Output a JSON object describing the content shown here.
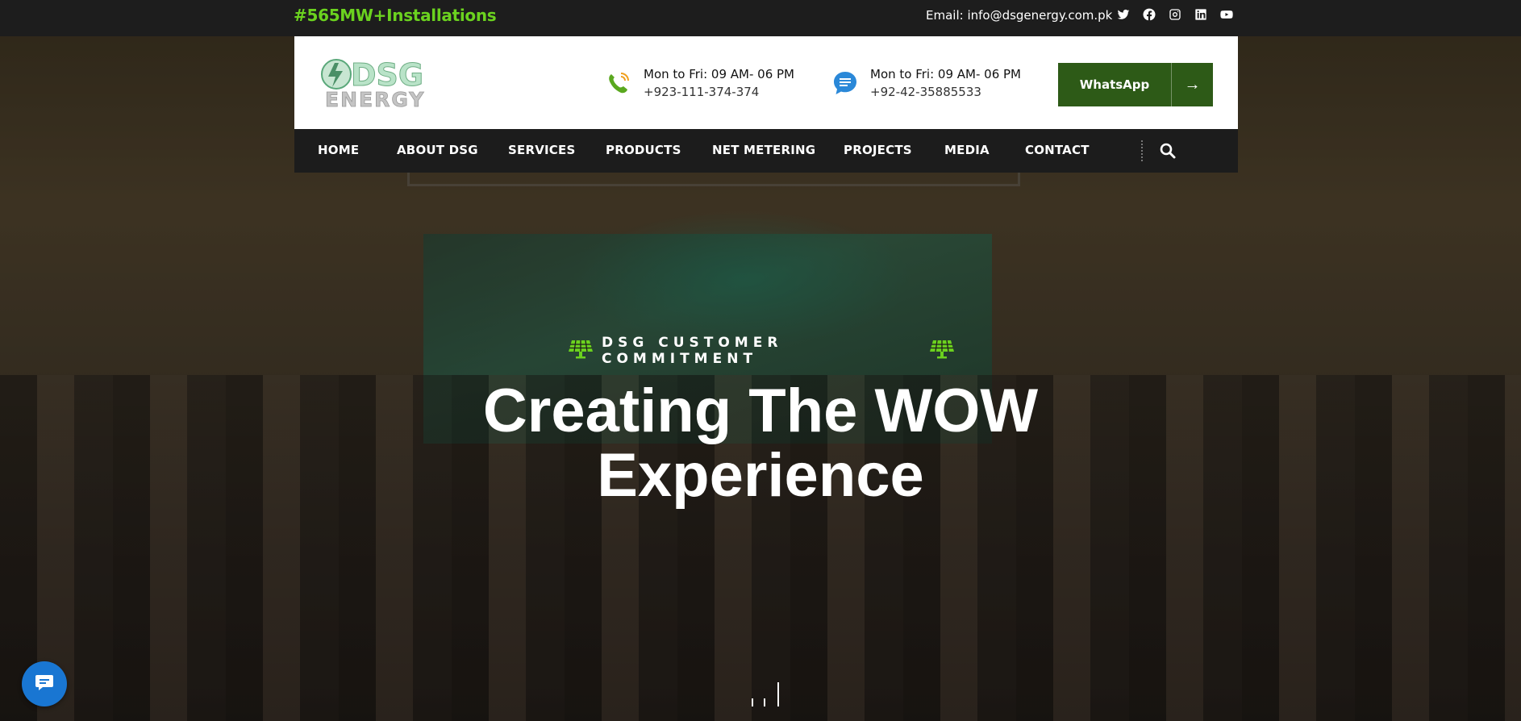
{
  "topbar": {
    "installations": "#565MW+Installations",
    "email": "Email: info@dsgenergy.com.pk",
    "socials": [
      "twitter-icon",
      "facebook-icon",
      "instagram-icon",
      "linkedin-icon",
      "youtube-icon"
    ]
  },
  "header": {
    "logo_top": "DSG",
    "logo_bottom": "ENERGY",
    "contacts": [
      {
        "hours": "Mon to Fri: 09 AM- 06 PM",
        "value": "+923-111-374-374",
        "icon": "phone-icon"
      },
      {
        "hours": "Mon to Fri: 09 AM- 06 PM",
        "value": "+92-42-35885533",
        "icon": "chat-icon"
      }
    ],
    "cta_label": "WhatsApp",
    "cta_arrow": "→"
  },
  "nav": {
    "items": [
      "HOME",
      "ABOUT DSG",
      "SERVICES",
      "PRODUCTS",
      "NET METERING",
      "PROJECTS",
      "MEDIA",
      "CONTACT"
    ]
  },
  "hero": {
    "tagline": "DSG CUSTOMER COMMITMENT",
    "headline_line1": "Creating The WOW",
    "headline_line2": "Experience"
  },
  "colors": {
    "accent_green": "#6bd21f",
    "cta_green": "#2d5a17",
    "topbar": "#1d1d1d",
    "nav": "#1c1c1c",
    "chat_blue": "#1976d2"
  }
}
